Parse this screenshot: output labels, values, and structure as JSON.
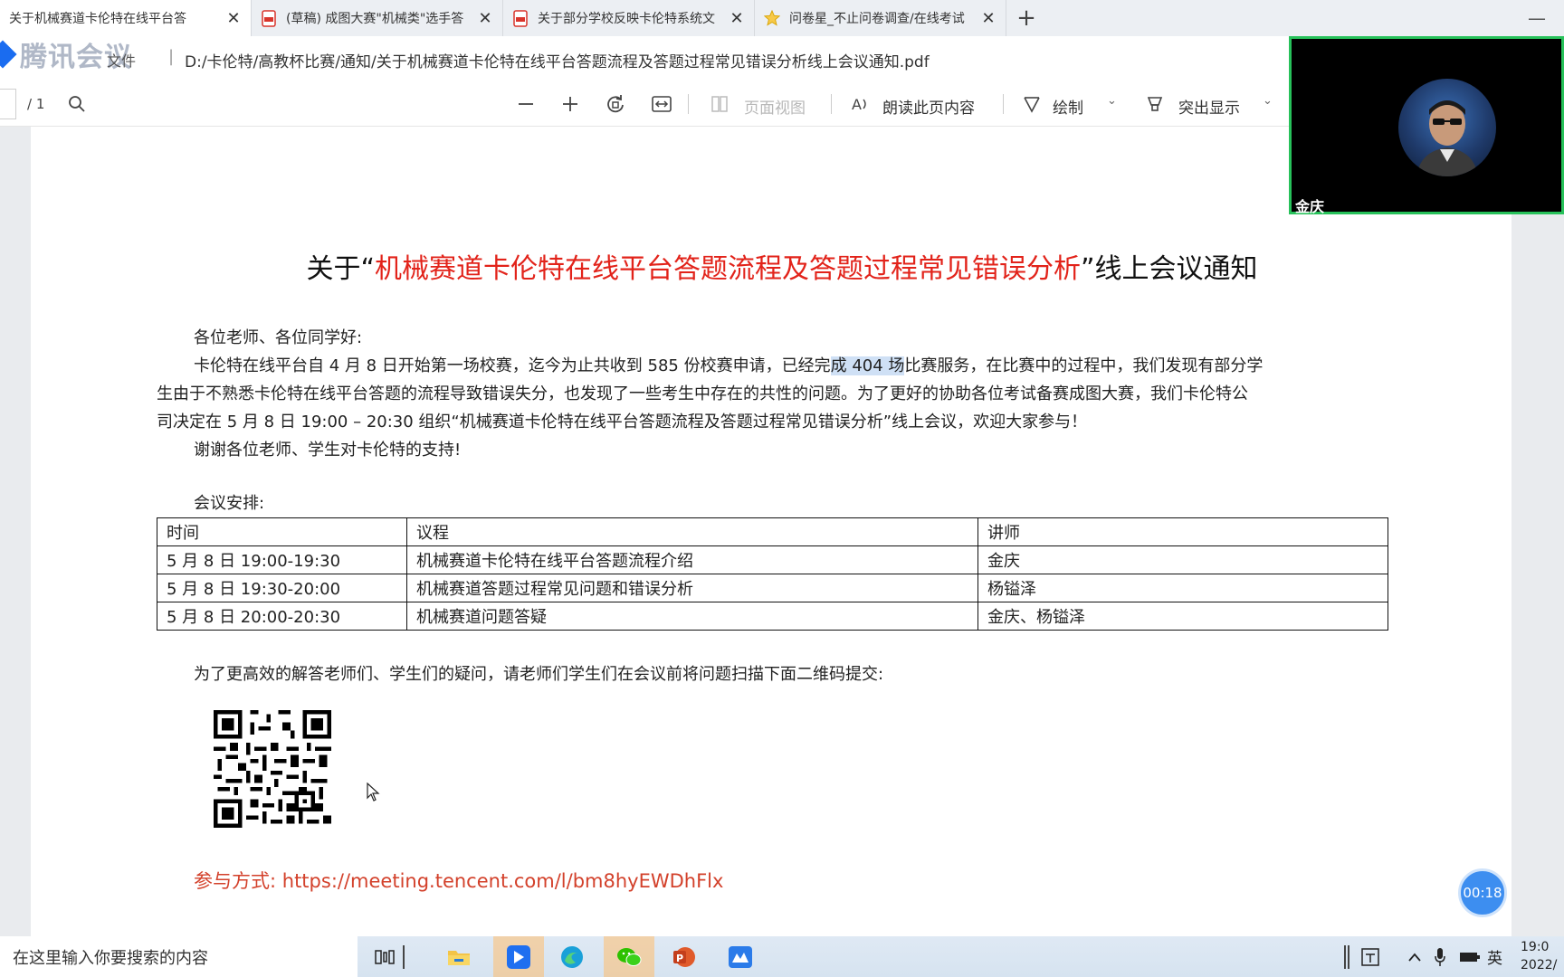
{
  "tabs": [
    {
      "title": "关于机械赛道卡伦特在线平台答",
      "icon": "none",
      "active": true
    },
    {
      "title": "(草稿) 成图大赛\"机械类\"选手答",
      "icon": "pdf-icon",
      "active": false
    },
    {
      "title": "关于部分学校反映卡伦特系统文",
      "icon": "pdf-icon",
      "active": false
    },
    {
      "title": "问卷星_不止问卷调查/在线考试",
      "icon": "star-icon",
      "active": false
    }
  ],
  "new_tab": "+",
  "minimize": "—",
  "watermark": "腾讯会议",
  "address": {
    "file_label": "文件",
    "separator": "|",
    "path": "D:/卡伦特/高教杯比赛/通知/关于机械赛道卡伦特在线平台答题流程及答题过程常见错误分析线上会议通知.pdf"
  },
  "toolbar": {
    "page_count": "/ 1",
    "page_view": "页面视图",
    "read_aloud": "朗读此页内容",
    "draw": "绘制",
    "highlight": "突出显示"
  },
  "document": {
    "title_prefix": "关于“",
    "title_red": "机械赛道卡伦特在线平台答题流程及答题过程常见错误分析",
    "title_suffix": "”线上会议通知",
    "greeting": "各位老师、各位同学好:",
    "p1_a": "卡伦特在线平台自 4 月 8 日开始第一场校赛，迄今为止共收到 585 份校赛申请，已经完",
    "p1_hl": "成 404 场",
    "p1_b": "比赛服务，在比赛中的过程中，我们发现有部分学",
    "p2": "生由于不熟悉卡伦特在线平台答题的流程导致错误失分，也发现了一些考生中存在的共性的问题。为了更好的协助各位考试备赛成图大赛，我们卡伦特公",
    "p3": "司决定在 5 月 8 日 19:00 – 20:30 组织“机械赛道卡伦特在线平台答题流程及答题过程常见错误分析”线上会议，欢迎大家参与！",
    "thanks": "谢谢各位老师、学生对卡伦特的支持!",
    "schedule_label": "会议安排:",
    "table_headers": [
      "时间",
      "议程",
      "讲师"
    ],
    "table_rows": [
      [
        "5 月 8 日 19:00-19:30",
        "机械赛道卡伦特在线平台答题流程介绍",
        "金庆"
      ],
      [
        "5 月 8 日 19:30-20:00",
        "机械赛道答题过程常见问题和错误分析",
        "杨镒泽"
      ],
      [
        "5 月 8 日 20:00-20:30",
        "机械赛道问题答疑",
        "金庆、杨镒泽"
      ]
    ],
    "qr_instruction": "为了更高效的解答老师们、学生们的疑问，请老师们学生们在会议前将问题扫描下面二维码提交:",
    "join_label": "参与方式:",
    "join_link": "https://meeting.tencent.com/l/bm8hyEWDhFlx"
  },
  "video": {
    "name": "金庆"
  },
  "timer": "00:18",
  "taskbar": {
    "search_placeholder": "在这里输入你要搜索的内容",
    "ime_label": "英",
    "clock_time": "19:0",
    "clock_date": "2022/"
  },
  "colors": {
    "title_red": "#e2231a",
    "link_red": "#d3412b",
    "highlight": "#cfe0f5",
    "video_border": "#27c15a",
    "timer_blue": "#3d8ef0"
  }
}
